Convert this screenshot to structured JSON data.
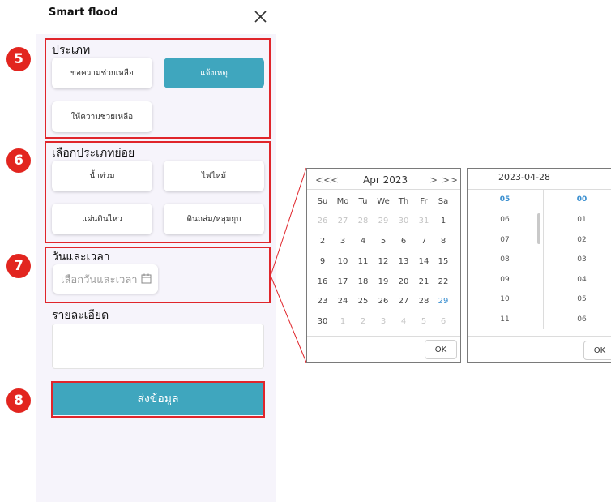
{
  "app": {
    "title": "Smart flood"
  },
  "badges": [
    "5",
    "6",
    "7",
    "8"
  ],
  "type_section": {
    "label": "ประเภท",
    "options": [
      {
        "label": "ขอความช่วยเหลือ",
        "selected": false
      },
      {
        "label": "แจ้งเหตุ",
        "selected": true
      },
      {
        "label": "ให้ความช่วยเหลือ",
        "selected": false
      }
    ]
  },
  "subtype_section": {
    "label": "เลือกประเภทย่อย",
    "options": [
      {
        "label": "น้ำท่วม"
      },
      {
        "label": "ไฟไหม้"
      },
      {
        "label": "แผ่นดินไหว"
      },
      {
        "label": "ดินถล่ม/หลุมยุบ"
      }
    ]
  },
  "datetime_section": {
    "label": "วันและเวลา",
    "placeholder": "เลือกวันและเวลา"
  },
  "detail_section": {
    "label": "รายละเอียด"
  },
  "submit": {
    "label": "ส่งข้อมูล"
  },
  "calendar": {
    "nav_prev_year": "<<",
    "nav_prev_month": "<",
    "nav_next_month": ">",
    "nav_next_year": ">>",
    "month_label": "Apr 2023",
    "weekdays": [
      "Su",
      "Mo",
      "Tu",
      "We",
      "Th",
      "Fr",
      "Sa"
    ],
    "weeks": [
      [
        "26",
        "27",
        "28",
        "29",
        "30",
        "31",
        "1"
      ],
      [
        "2",
        "3",
        "4",
        "5",
        "6",
        "7",
        "8"
      ],
      [
        "9",
        "10",
        "11",
        "12",
        "13",
        "14",
        "15"
      ],
      [
        "16",
        "17",
        "18",
        "19",
        "20",
        "21",
        "22"
      ],
      [
        "23",
        "24",
        "25",
        "26",
        "27",
        "28",
        "29"
      ],
      [
        "30",
        "1",
        "2",
        "3",
        "4",
        "5",
        "6"
      ]
    ],
    "ok_label": "OK"
  },
  "time_picker": {
    "date_label": "2023-04-28",
    "hours": [
      "05",
      "06",
      "07",
      "08",
      "09",
      "10",
      "11"
    ],
    "minutes": [
      "00",
      "01",
      "02",
      "03",
      "04",
      "05",
      "06"
    ],
    "ok_label": "OK"
  },
  "colors": {
    "accent": "#3fa6be",
    "highlight": "#e0252b",
    "link_blue": "#3a8fd0",
    "panel_bg": "#f6f4fb"
  }
}
